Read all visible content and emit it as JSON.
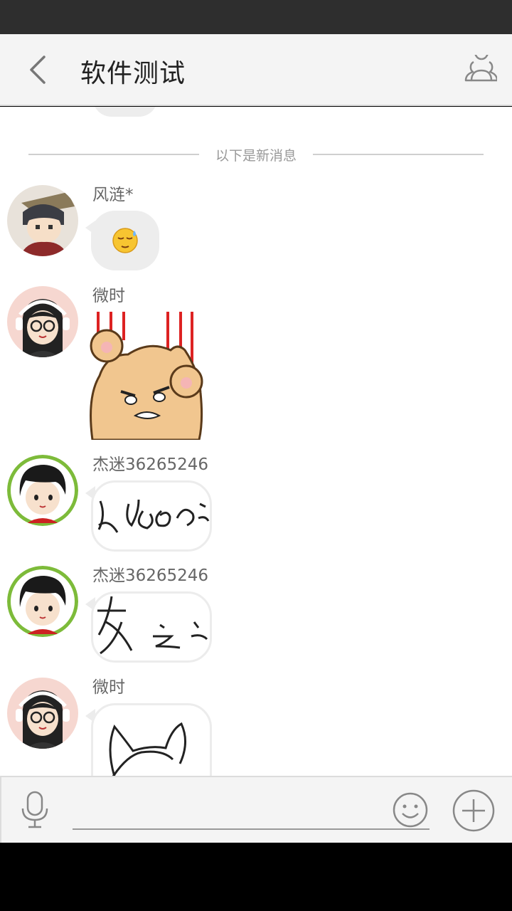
{
  "header": {
    "title": "软件测试",
    "back_icon": "chevron-left-icon",
    "members_icon": "group-members-icon"
  },
  "chat": {
    "divider_text": "以下是新消息",
    "messages": [
      {
        "sender": "风涟*",
        "content_type": "emoji",
        "content_icon": "sleepy-sweat-face-emoji"
      },
      {
        "sender": "微时",
        "content_type": "sticker",
        "content_icon": "angry-cat-scratching-sticker"
      },
      {
        "sender": "杰迷36265246",
        "content_type": "handwriting",
        "content_icon": "handwriting-image"
      },
      {
        "sender": "杰迷36265246",
        "content_type": "handwriting",
        "content_icon": "handwriting-image"
      },
      {
        "sender": "微时",
        "content_type": "drawing",
        "content_icon": "cat-sketch-image"
      }
    ]
  },
  "input_bar": {
    "mic_icon": "microphone-icon",
    "text_value": "",
    "emoji_icon": "smiley-icon",
    "plus_icon": "plus-circle-icon"
  },
  "colors": {
    "header_bg": "#f4f4f4",
    "bubble_bg": "#ededed",
    "status_bar": "#2e2e2e",
    "avatar_ring_green": "#7dbb3a",
    "avatar_ring_red": "#e98c8c"
  }
}
